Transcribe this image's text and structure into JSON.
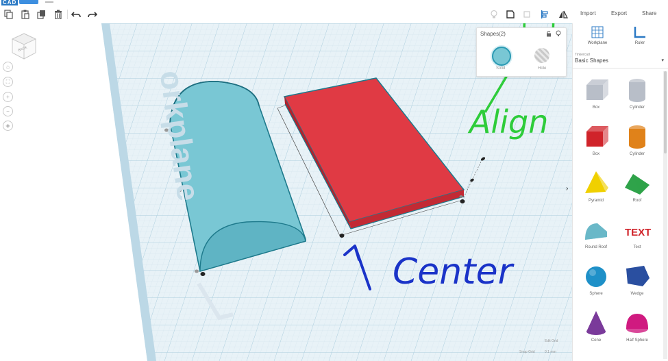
{
  "app": {
    "logo_text": "CAD"
  },
  "toolbar": {
    "import_label": "Import",
    "export_label": "Export",
    "share_label": "Share"
  },
  "viewport": {
    "workplane_watermark": "orkplane",
    "viewcube_label": "BACK"
  },
  "shapes_panel": {
    "title": "Shapes(2)",
    "solid_label": "Solid",
    "hole_label": "Hole"
  },
  "sidebar": {
    "workplane_label": "Workplane",
    "ruler_label": "Ruler",
    "library_caption": "Tinkercad",
    "library_name": "Basic Shapes",
    "shapes": [
      {
        "label": "Box",
        "color": "#b8bec8"
      },
      {
        "label": "Cylinder",
        "color": "#b8bec8"
      },
      {
        "label": "Box",
        "color": "#d0232a"
      },
      {
        "label": "Cylinder",
        "color": "#e0821a"
      },
      {
        "label": "Pyramid",
        "color": "#f0d000"
      },
      {
        "label": "Roof",
        "color": "#2fa34a"
      },
      {
        "label": "Round Roof",
        "color": "#6ab8c8"
      },
      {
        "label": "Text",
        "color": "#d0232a"
      },
      {
        "label": "Sphere",
        "color": "#1e90c8"
      },
      {
        "label": "Wedge",
        "color": "#2a4fa0"
      },
      {
        "label": "Cone",
        "color": "#7a3a9a"
      },
      {
        "label": "Half Sphere",
        "color": "#d01a80"
      }
    ]
  },
  "grid_controls": {
    "edit_grid_label": "Edit Grid",
    "snap_grid_label": "Snap Grid",
    "snap_grid_value": "0.1 mm"
  },
  "annotations": {
    "align_text": "Align",
    "center_text": "Center"
  }
}
